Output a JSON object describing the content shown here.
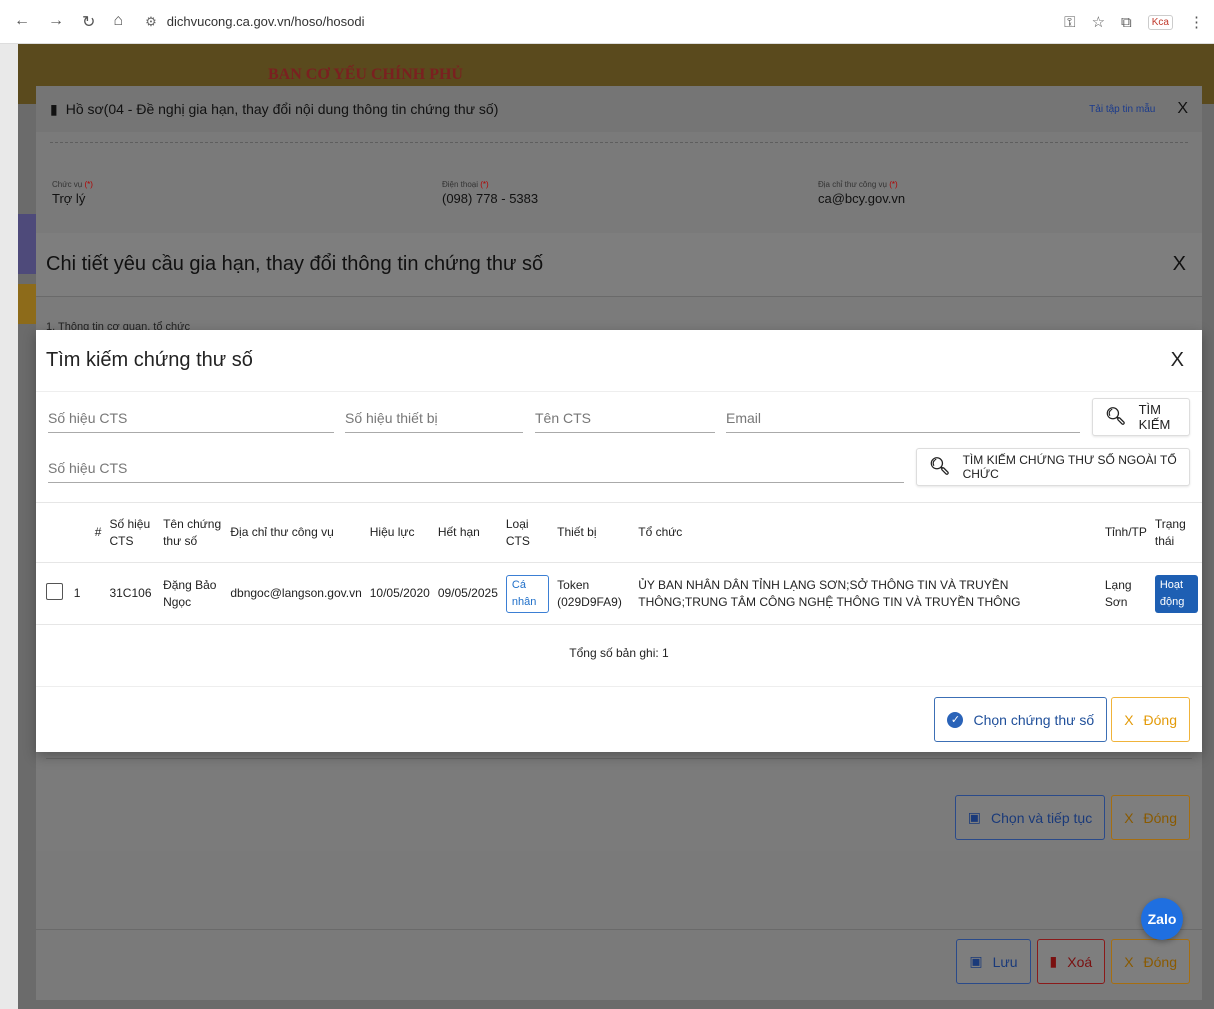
{
  "browser": {
    "url": "dichvucong.ca.gov.vn/hoso/hosodi",
    "extension_label": "Kca"
  },
  "banner": {
    "title": "BAN CƠ YẾU CHÍNH PHỦ"
  },
  "dialog1": {
    "title": "Hồ sơ(04 - Đề nghị gia hạn, thay đổi nội dung thông tin chứng thư số)",
    "template_link": "Tải tập tin mẫu",
    "close": "X",
    "fields": [
      {
        "label": "Chức vụ",
        "required": "(*)",
        "value": "Trợ lý"
      },
      {
        "label": "Điện thoại",
        "required": "(*)",
        "value": "(098) 778 - 5383"
      },
      {
        "label": "Địa chỉ thư công vụ",
        "required": "(*)",
        "value": "ca@bcy.gov.vn"
      }
    ],
    "buttons": {
      "save": "Lưu",
      "delete": "Xoá",
      "close": "Đóng"
    }
  },
  "dialog2": {
    "title": "Chi tiết yêu cầu gia hạn, thay đổi thông tin chứng thư số",
    "close": "X",
    "section_label": "1. Thông tin cơ quan, tổ chức",
    "buttons": {
      "select_continue": "Chọn và tiếp tục",
      "close": "Đóng"
    }
  },
  "dialog3": {
    "title": "Tìm kiếm chứng thư số",
    "close": "X",
    "search": {
      "serial_placeholder": "Số hiệu CTS",
      "device_placeholder": "Số hiệu thiết bị",
      "name_placeholder": "Tên CTS",
      "email_placeholder": "Email",
      "search_button": "TÌM KIẾM",
      "serial2_placeholder": "Số hiệu CTS",
      "search_outside_button": "TÌM KIẾM CHỨNG THƯ SỐ NGOÀI TỔ CHỨC"
    },
    "table": {
      "headers": [
        "#",
        "Số hiệu CTS",
        "Tên chứng thư số",
        "Địa chỉ thư công vụ",
        "Hiệu lực",
        "Hết hạn",
        "Loại CTS",
        "Thiết bị",
        "Tổ chức",
        "Tỉnh/TP",
        "Trạng thái"
      ],
      "rows": [
        {
          "index": "1",
          "serial": "31C106",
          "name": "Đặng Bảo Ngọc",
          "email": "dbngoc@langson.gov.vn",
          "valid_from": "10/05/2020",
          "expires": "09/05/2025",
          "type": "Cá nhân",
          "device": "Token (029D9FA9)",
          "org": "ỦY BAN NHÂN DÂN TỈNH LẠNG SƠN;SỞ THÔNG TIN VÀ TRUYỀN THÔNG;TRUNG TÂM CÔNG NGHỆ THÔNG TIN VÀ TRUYỀN THÔNG",
          "province": "Lạng Sơn",
          "status": "Hoạt động"
        }
      ]
    },
    "total": "Tổng số bản ghi: 1",
    "buttons": {
      "select": "Chọn chứng thư số",
      "close": "Đóng",
      "close_icon": "X"
    }
  },
  "zalo": {
    "label": "Zalo"
  },
  "colors": {
    "primary": "#1e5fb3",
    "accent_orange": "#f0b33a",
    "overlay": "#6b6b6b"
  }
}
